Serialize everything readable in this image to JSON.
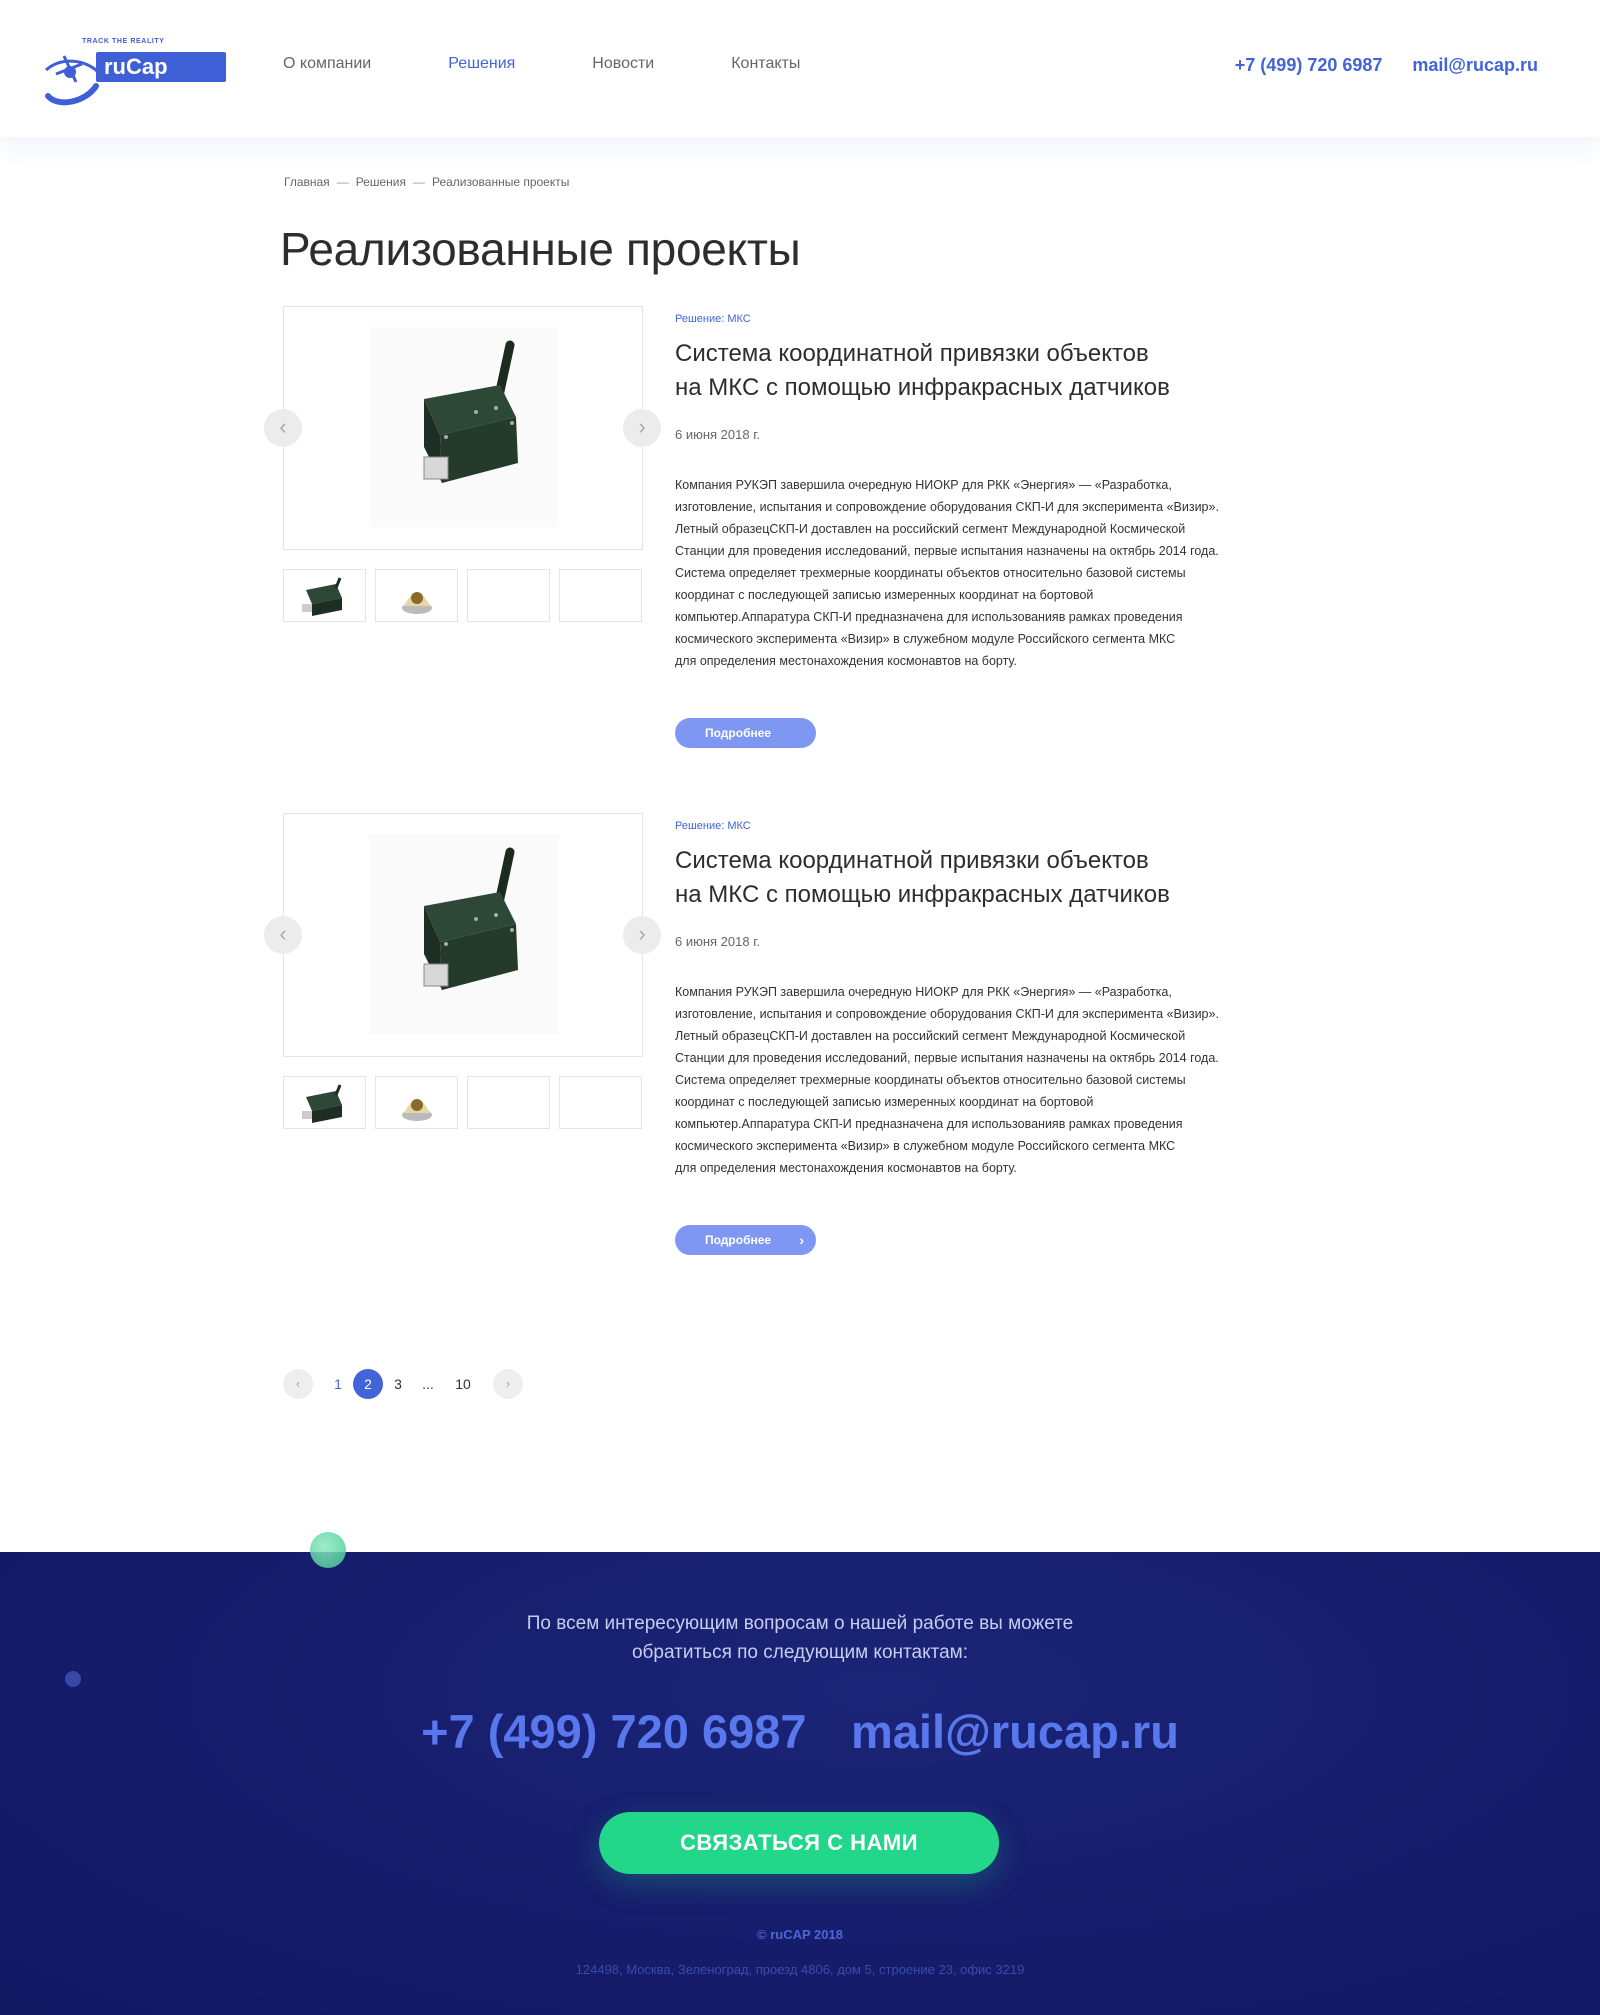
{
  "header": {
    "logo_tagline": "TRACK THE REALITY",
    "logo_text": "ruCap",
    "nav": [
      {
        "label": "О компании"
      },
      {
        "label": "Решения"
      },
      {
        "label": "Новости"
      },
      {
        "label": "Контакты"
      }
    ],
    "phone": "+7 (499) 720 6987",
    "email": "mail@rucap.ru"
  },
  "breadcrumb": [
    "Главная",
    "Решения",
    "Реализованные проекты"
  ],
  "breadcrumb_sep": "—",
  "page_title": "Реализованные проекты",
  "projects": [
    {
      "category": "Решение: МКС",
      "title": "Система координатной привязки объектов\nна МКС с помощью инфракрасных датчиков",
      "date": "6 июня 2018 г.",
      "description": "Компания РУКЭП завершила очередную НИОКР для РКК «Энергия» — «Разработка,\nизготовление, испытания и сопровождение оборудования СКП-И для эксперимента «Визир».\nЛетный образецСКП-И доставлен на российский сегмент Международной Космической\nСтанции для проведения исследований, первые испытания назначены на октябрь 2014 года.\nСистема определяет трехмерные координаты объектов относительно базовой системы\nкоординат с последующей записью измеренных координат на бортовой\nкомпьютер.Аппаратура СКП-И предназначена для использованияв рамках проведения\nкосмического эксперимента «Визир» в служебном модуле Российского сегмента МКС\nдля определения местонахождения космонавтов на борту.",
      "button": "Подробнее"
    },
    {
      "category": "Решение: МКС",
      "title": "Система координатной привязки объектов\nна МКС с помощью инфракрасных датчиков",
      "date": "6 июня 2018 г.",
      "description": "Компания РУКЭП завершила очередную НИОКР для РКК «Энергия» — «Разработка,\nизготовление, испытания и сопровождение оборудования СКП-И для эксперимента «Визир».\nЛетный образецСКП-И доставлен на российский сегмент Международной Космической\nСтанции для проведения исследований, первые испытания назначены на октябрь 2014 года.\nСистема определяет трехмерные координаты объектов относительно базовой системы\nкоординат с последующей записью измеренных координат на бортовой\nкомпьютер.Аппаратура СКП-И предназначена для использованияв рамках проведения\nкосмического эксперимента «Визир» в служебном модуле Российского сегмента МКС\nдля определения местонахождения космонавтов на борту.",
      "button": "Подробнее"
    }
  ],
  "pagination": {
    "pages": [
      "1",
      "2",
      "3",
      "...",
      "10"
    ],
    "current": "2"
  },
  "footer": {
    "intro": "По всем интересующим вопросам о нашей работе вы можете\nобратиться по следующим контактам:",
    "phone": "+7 (499) 720 6987",
    "email": "mail@rucap.ru",
    "cta": "СВЯЗАТЬСЯ С НАМИ",
    "copyright": "© ruCAP 2018",
    "address": "124498, Москва, Зеленоград, проезд 4806, дом 5, строение 23, офис 3219"
  },
  "colors": {
    "accent": "#4164d8",
    "button": "#7e97f2",
    "footer_bg": "#151c6a",
    "cta_green": "#22d68a"
  }
}
